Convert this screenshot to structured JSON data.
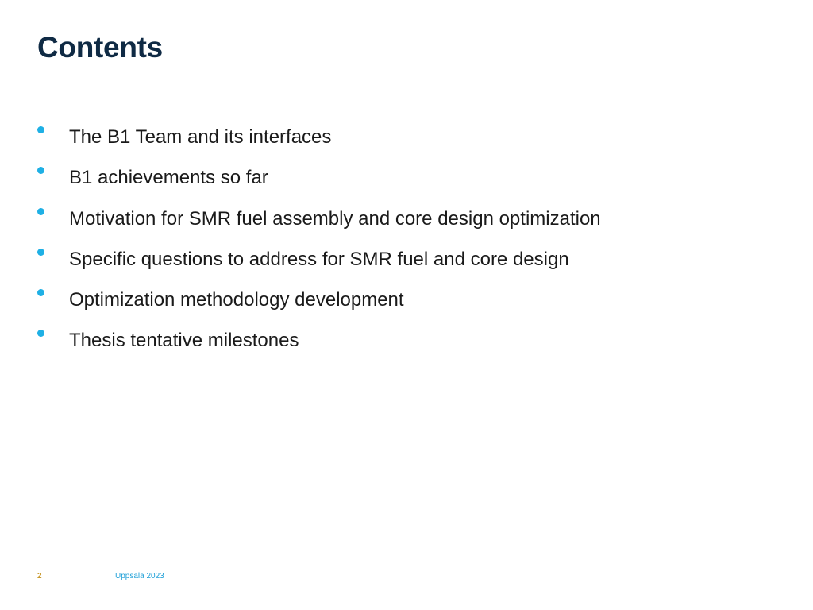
{
  "slide": {
    "title": "Contents",
    "bullets": [
      {
        "text": "The B1 Team and its interfaces"
      },
      {
        "text": "B1 achievements so far"
      },
      {
        "text": "Motivation for SMR fuel assembly and core design optimization"
      },
      {
        "text": "Specific questions to address for SMR fuel and core design"
      },
      {
        "text": "Optimization methodology development"
      },
      {
        "text": "Thesis tentative milestones"
      }
    ]
  },
  "footer": {
    "page_number": "2",
    "text": "Uppsala 2023"
  },
  "colors": {
    "title": "#0f2a44",
    "bullet": "#1fb0e5",
    "body_text": "#1a1a1a",
    "page_number": "#c99a2e",
    "footer_text": "#1fa0d8"
  }
}
